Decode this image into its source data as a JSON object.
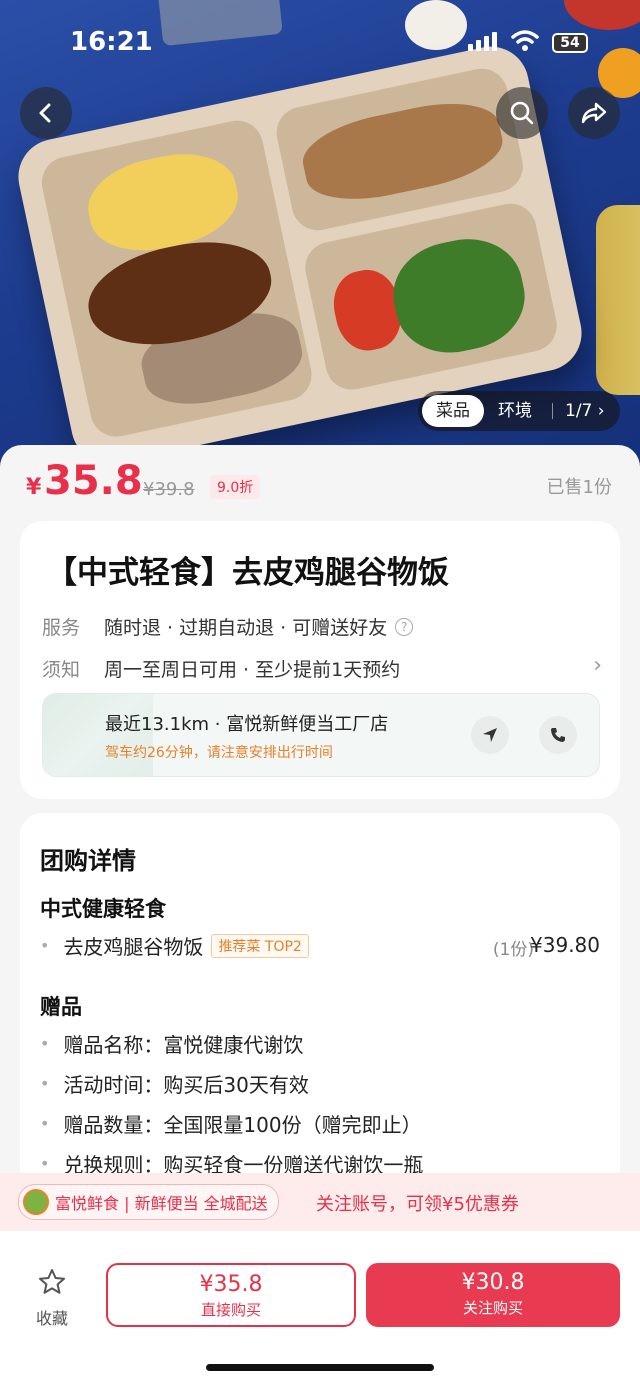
{
  "status_bar": {
    "time": "16:21",
    "battery": "54"
  },
  "hero": {
    "tabs": [
      {
        "label": "菜品",
        "active": true
      },
      {
        "label": "环境",
        "active": false
      }
    ],
    "page_indicator": "1/7"
  },
  "price": {
    "currency": "¥",
    "current": "35.8",
    "original": "¥39.8",
    "discount": "9.0折",
    "sold": "已售1份"
  },
  "product": {
    "title": "【中式轻食】去皮鸡腿谷物饭",
    "service_label": "服务",
    "service_text": "随时退 · 过期自动退 · 可赠送好友",
    "notice_label": "须知",
    "notice_text": "周一至周日可用 · 至少提前1天预约"
  },
  "store": {
    "line1": "最近13.1km · 富悦新鲜便当工厂店",
    "line2": "驾车约26分钟，请注意安排出行时间"
  },
  "details": {
    "heading": "团购详情",
    "section1_title": "中式健康轻食",
    "item_name": "去皮鸡腿谷物饭",
    "item_tag": "推荐菜 TOP2",
    "item_qty": "(1份)",
    "item_price": "¥39.80",
    "gift_title": "赠品",
    "gift_items": [
      "赠品名称：富悦健康代谢饮",
      "活动时间：购买后30天有效",
      "赠品数量：全国限量100份（赠完即止）",
      "兑换规则：购买轻食一份赠送代谢饮一瓶"
    ]
  },
  "follow_banner": {
    "account": "富悦鲜食 | 新鲜便当 全城配送",
    "offer": "关注账号，可领¥5优惠券"
  },
  "bottom": {
    "favorite_label": "收藏",
    "buy_price": "¥35.8",
    "buy_label": "直接购买",
    "follow_price": "¥30.8",
    "follow_label": "关注购买"
  },
  "colors": {
    "accent": "#e8304a",
    "orange": "#e8812a"
  }
}
